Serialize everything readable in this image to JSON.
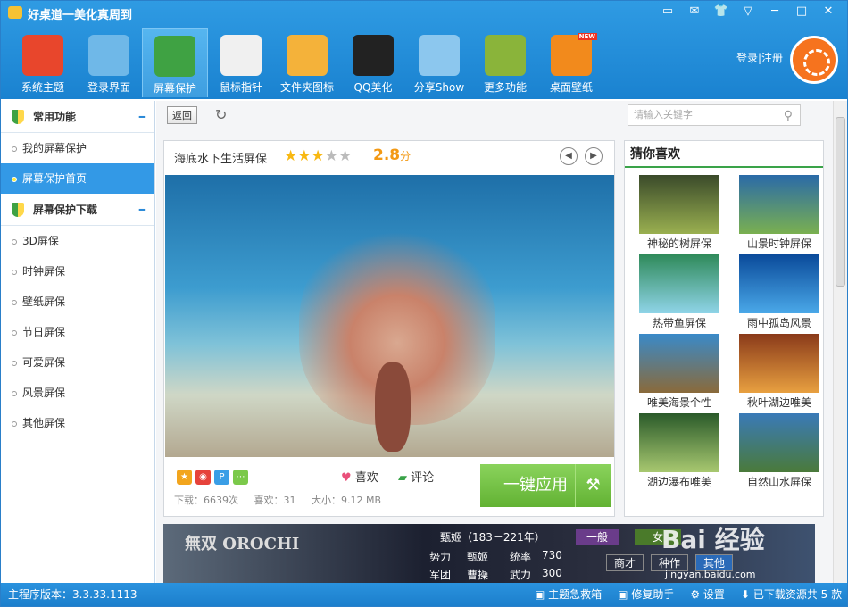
{
  "window": {
    "title": "好桌道一美化真周到",
    "controls": [
      "▭",
      "✉",
      "👕",
      "▽",
      "─",
      "□",
      "✕"
    ]
  },
  "nav": {
    "items": [
      {
        "label": "系统主题",
        "icon": "windows-logo-icon",
        "color": "#e8462c"
      },
      {
        "label": "登录界面",
        "icon": "monitor-icon",
        "color": "#6fb8e8"
      },
      {
        "label": "屏幕保护",
        "icon": "shield-icon",
        "color": "#3fa243"
      },
      {
        "label": "鼠标指针",
        "icon": "paper-plane-icon",
        "color": "#f0f0f0"
      },
      {
        "label": "文件夹图标",
        "icon": "folder-icon",
        "color": "#f4b23a"
      },
      {
        "label": "QQ美化",
        "icon": "qq-penguin-icon",
        "color": "#222222"
      },
      {
        "label": "分享Show",
        "icon": "share-icon",
        "color": "#8cc7ee"
      },
      {
        "label": "更多功能",
        "icon": "gear-icon",
        "color": "#8ab43a"
      },
      {
        "label": "桌面壁纸",
        "icon": "wallpaper-icon",
        "color": "#f28a1c",
        "badge": "NEW"
      }
    ],
    "active_index": 2
  },
  "account": {
    "login_text": "登录|注册"
  },
  "sidebar": {
    "sections": [
      {
        "title": "常用功能",
        "items": [
          "我的屏幕保护",
          "屏幕保护首页"
        ]
      },
      {
        "title": "屏幕保护下载",
        "items": [
          "3D屏保",
          "时钟屏保",
          "壁纸屏保",
          "节日屏保",
          "可爱屏保",
          "风景屏保",
          "其他屏保"
        ]
      }
    ],
    "active_item": "屏幕保护首页"
  },
  "toolbar": {
    "back_label": "返回",
    "search_placeholder": "请输入关键字"
  },
  "feature": {
    "title": "海底水下生活屏保",
    "rating": 2.8,
    "rating_text": "2.8",
    "rating_unit": "分",
    "stars_filled": 3,
    "stars_total": 5,
    "like_label": "喜欢",
    "comment_label": "评论",
    "downloads": "下载：6639次",
    "likes": "喜欢：31",
    "size": "大小：9.12 MB",
    "apply_label": "一键应用"
  },
  "recommend": {
    "title": "猜你喜欢",
    "items": [
      {
        "label": "神秘的树屏保",
        "colors": [
          "#3a4a2a",
          "#9ab050"
        ]
      },
      {
        "label": "山景时钟屏保",
        "colors": [
          "#2a6aa8",
          "#7ab050"
        ]
      },
      {
        "label": "热带鱼屏保",
        "colors": [
          "#2f8a5a",
          "#8fd4e8"
        ]
      },
      {
        "label": "雨中孤岛风景",
        "colors": [
          "#0a4a9a",
          "#4aa8e8"
        ]
      },
      {
        "label": "唯美海景个性",
        "colors": [
          "#3a8ac8",
          "#8a6a3a"
        ]
      },
      {
        "label": "秋叶湖边唯美",
        "colors": [
          "#8a3a1a",
          "#e8a040"
        ]
      },
      {
        "label": "湖边瀑布唯美",
        "colors": [
          "#2a5a2a",
          "#a8c870"
        ]
      },
      {
        "label": "自然山水屏保",
        "colors": [
          "#3a7ab8",
          "#4a7a3a"
        ]
      }
    ]
  },
  "banner": {
    "logo": "無双 OROCHI",
    "name": "甄姬（183－221年）",
    "rank": "一般",
    "gender": "女",
    "faction_label": "势力",
    "faction": "甄姬",
    "command_label": "统率",
    "command": "730",
    "army_label": "军团",
    "army": "曹操",
    "force_label": "武力",
    "force": "300",
    "btns": [
      "商才",
      "种作",
      "其他"
    ]
  },
  "status": {
    "version": "主程序版本：3.3.33.1113",
    "links": [
      "主题急救箱",
      "修复助手",
      "设置",
      "已下载资源共 5 款"
    ]
  },
  "watermark": {
    "text": "Bai 经验",
    "sub": "jingyan.baidu.com"
  }
}
